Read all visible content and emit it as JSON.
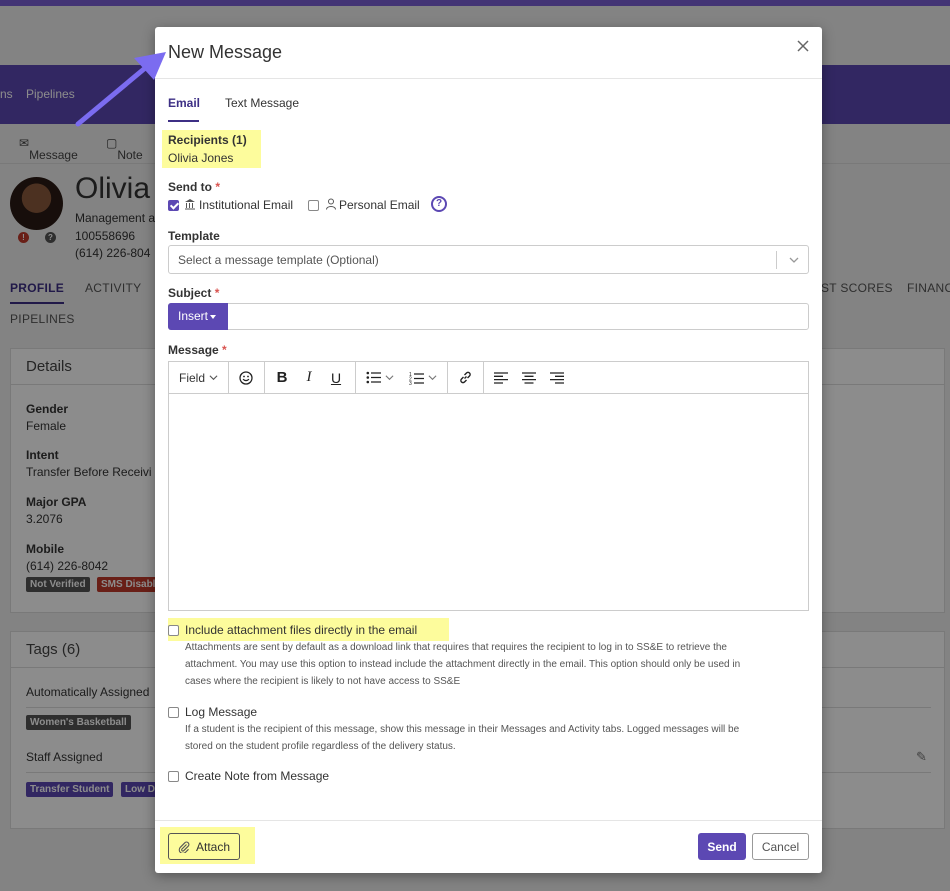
{
  "background": {
    "nav_items": [
      "ns",
      "Pipelines"
    ],
    "actions": {
      "message": "Message",
      "note": "Note"
    },
    "profile": {
      "name": "Olivia",
      "subtitle": "Management a",
      "id": "100558696",
      "phone": "(614) 226-804"
    },
    "tabs": {
      "profile": "PROFILE",
      "activity": "ACTIVITY",
      "test_scores": "ST SCORES",
      "finance": "FINANC",
      "pipelines": "PIPELINES"
    },
    "details": {
      "title": "Details",
      "gender_label": "Gender",
      "gender_value": "Female",
      "intent_label": "Intent",
      "intent_value": "Transfer Before Receivi",
      "gpa_label": "Major GPA",
      "gpa_value": "3.2076",
      "mobile_label": "Mobile",
      "mobile_value": "(614) 226-8042",
      "badge_not_verified": "Not Verified",
      "badge_sms": "SMS Disabl"
    },
    "tags": {
      "title": "Tags (6)",
      "auto_label": "Automatically Assigned",
      "auto_tag": "Women's Basketball",
      "staff_label": "Staff Assigned",
      "staff_tag_1": "Transfer Student",
      "staff_tag_2": "Low D"
    }
  },
  "modal": {
    "title": "New Message",
    "tabs": {
      "email": "Email",
      "text": "Text Message"
    },
    "recipients": {
      "label": "Recipients (1)",
      "name": "Olivia Jones"
    },
    "send_to": {
      "label": "Send to",
      "required": "*",
      "institutional": "Institutional Email",
      "institutional_checked": true,
      "personal": "Personal Email",
      "personal_checked": false,
      "help": "?"
    },
    "template": {
      "label": "Template",
      "placeholder": "Select a message template (Optional)"
    },
    "subject": {
      "label": "Subject",
      "required": "*",
      "insert_label": "Insert",
      "value": ""
    },
    "message": {
      "label": "Message",
      "required": "*",
      "field_label": "Field"
    },
    "options": {
      "include_attachments": {
        "label": "Include attachment files directly in the email",
        "help_lines": [
          "Attachments are sent by default as a download link that requires that requires the recipient to log in to SS&E to retrieve the",
          "attachment. You may use this option to instead include the attachment directly in the email. This option should only be used in",
          "cases where the recipient is likely to not have access to SS&E"
        ]
      },
      "log_message": {
        "label": "Log Message",
        "help_lines": [
          "If a student is the recipient of this message, show this message in their Messages and Activity tabs. Logged messages will be",
          "stored on the student profile regardless of the delivery status."
        ]
      },
      "create_note": {
        "label": "Create Note from Message"
      }
    },
    "footer": {
      "attach": "Attach",
      "send": "Send",
      "cancel": "Cancel"
    }
  },
  "colors": {
    "accent": "#5c48b3",
    "highlight": "#fdfc9c",
    "required": "#d9534f",
    "annotation_arrow": "#7b6cf0"
  }
}
